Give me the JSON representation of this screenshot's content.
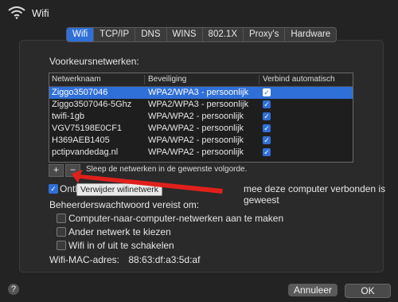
{
  "app": {
    "title": "Wifi"
  },
  "tabs": [
    {
      "label": "Wifi",
      "active": true
    },
    {
      "label": "TCP/IP"
    },
    {
      "label": "DNS"
    },
    {
      "label": "WINS"
    },
    {
      "label": "802.1X"
    },
    {
      "label": "Proxy's"
    },
    {
      "label": "Hardware"
    }
  ],
  "preferred": {
    "label": "Voorkeursnetwerken:",
    "columns": [
      "Netwerknaam",
      "Beveiliging",
      "Verbind automatisch"
    ],
    "rows": [
      {
        "name": "Ziggo3507046",
        "security": "WPA2/WPA3 - persoonlijk",
        "auto": true,
        "selected": true
      },
      {
        "name": "Ziggo3507046-5Ghz",
        "security": "WPA2/WPA3 - persoonlijk",
        "auto": true
      },
      {
        "name": "twifi-1gb",
        "security": "WPA/WPA2 - persoonlijk",
        "auto": true
      },
      {
        "name": "VGV75198E0CF1",
        "security": "WPA/WPA2 - persoonlijk",
        "auto": true
      },
      {
        "name": "H369AEB1405",
        "security": "WPA/WPA2 - persoonlijk",
        "auto": true
      },
      {
        "name": "pctipvandedag.nl",
        "security": "WPA/WPA2 - persoonlijk",
        "auto": true
      }
    ],
    "add_label": "+",
    "remove_label": "−",
    "drag_hint": "Sleep de netwerken in de gewenste volgorde."
  },
  "remember": {
    "text_start": "Onth",
    "text_end": "mee deze computer verbonden is geweest",
    "checked": true,
    "tooltip": "Verwijder wifinetwerk"
  },
  "admin": {
    "label": "Beheerderswachtwoord vereist om:",
    "options": [
      {
        "label": "Computer-naar-computer-netwerken aan te maken",
        "checked": false
      },
      {
        "label": "Ander netwerk te kiezen",
        "checked": false
      },
      {
        "label": "Wifi in of uit te schakelen",
        "checked": false
      }
    ]
  },
  "mac": {
    "label": "Wifi-MAC-adres:",
    "value": "88:63:df:a3:5d:af"
  },
  "footer": {
    "help": "?",
    "cancel": "Annuleer",
    "ok": "OK"
  },
  "colors": {
    "accent": "#2f6fd8",
    "arrow": "#e0201b"
  }
}
